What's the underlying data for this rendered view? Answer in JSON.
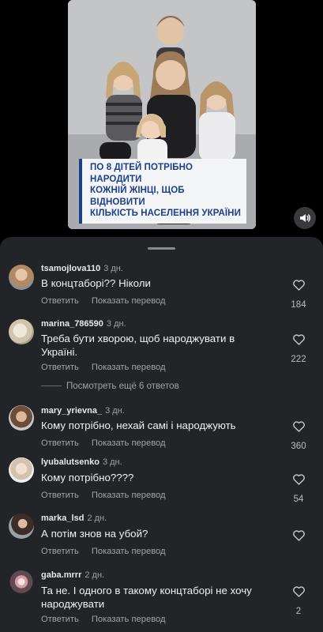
{
  "video": {
    "caption_lines": [
      "ПО 8 ДІТЕЙ ПОТРІБНО НАРОДИТИ",
      "КОЖНІЙ ЖІНЦІ, ЩОБ ВІДНОВИТИ",
      "КІЛЬКІСТЬ НАСЕЛЕННЯ УКРАЇНИ"
    ]
  },
  "comments": [
    {
      "username": "tsamojlova110",
      "ago": "3 дн.",
      "text": "В концтаборі?? Ніколи",
      "reply": "Ответить",
      "translate": "Показать перевод",
      "likes": "184"
    },
    {
      "username": "marina_786590",
      "ago": "3 дн.",
      "text": "Треба бути хворою, щоб народжувати в Україні.",
      "reply": "Ответить",
      "translate": "Показать перевод",
      "likes": "222",
      "more_replies": "Посмотреть ещё 6 ответов"
    },
    {
      "username": "mary_yrievna_",
      "ago": "3 дн.",
      "text": "Кому потрібно, нехай самі і народжують",
      "reply": "Ответить",
      "translate": "Показать перевод",
      "likes": "360"
    },
    {
      "username": "lyubalutsenko",
      "ago": "3 дн.",
      "text": "Кому потрібно????",
      "reply": "Ответить",
      "translate": "Показать перевод",
      "likes": "54"
    },
    {
      "username": "marka_lsd",
      "ago": "2 дн.",
      "text": "А потім знов на убой?",
      "reply": "Ответить",
      "translate": "Показать перевод",
      "likes": ""
    },
    {
      "username": "gaba.mrrr",
      "ago": "2 дн.",
      "text": "Та не.  І одного в такому концтаборі не хочу народжувати",
      "reply": "Ответить",
      "translate": "Показать перевод",
      "likes": "2"
    }
  ],
  "colors": {
    "sheet_bg": "#232427",
    "caption_text": "#1d3e8a",
    "secondary_text": "#a3a3a6"
  },
  "icons": [
    "speaker-icon",
    "heart-icon"
  ]
}
